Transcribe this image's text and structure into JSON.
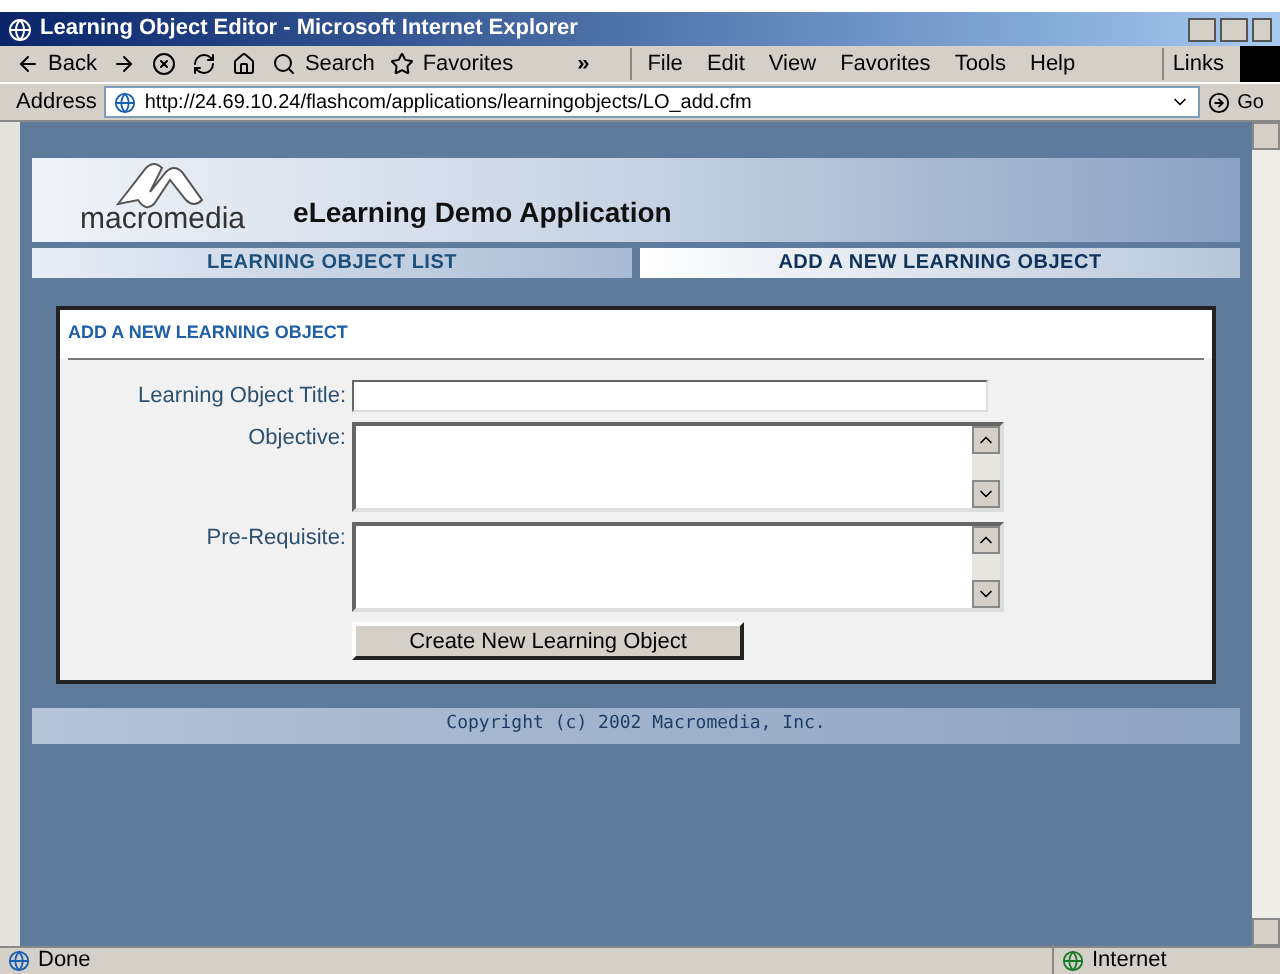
{
  "window": {
    "title": "Learning Object Editor - Microsoft Internet Explorer"
  },
  "toolbar": {
    "buttons": [
      {
        "label": "Back",
        "kind": "back"
      },
      {
        "kind": "forward"
      },
      {
        "kind": "stop"
      },
      {
        "kind": "refresh"
      },
      {
        "kind": "home"
      },
      {
        "label": "Search",
        "kind": "search"
      },
      {
        "label": "Favorites",
        "kind": "favorites"
      }
    ],
    "chevron": "»"
  },
  "menu": [
    "File",
    "Edit",
    "View",
    "Favorites",
    "Tools",
    "Help"
  ],
  "links": "Links",
  "address": {
    "label": "Address",
    "value": "http://24.69.10.24/flashcom/applications/learningobjects/LO_add.cfm",
    "go": "Go"
  },
  "header": {
    "logo": "macromedia",
    "app_title": "eLearning Demo Application"
  },
  "tabs": [
    {
      "label": "LEARNING OBJECT LIST",
      "selected": false
    },
    {
      "label": "ADD A NEW LEARNING OBJECT",
      "selected": true
    }
  ],
  "form": {
    "heading": "ADD A NEW LEARNING OBJECT",
    "fields": [
      {
        "label": "Learning Object Title:",
        "kind": "text"
      },
      {
        "label": "Objective:",
        "kind": "textarea"
      },
      {
        "label": "Pre-Requisite:",
        "kind": "textarea"
      }
    ],
    "submit": "Create New Learning Object"
  },
  "footer": "Copyright (c) 2002 Macromedia, Inc.",
  "status_bar": {
    "text": "Done",
    "zone": "Internet"
  }
}
